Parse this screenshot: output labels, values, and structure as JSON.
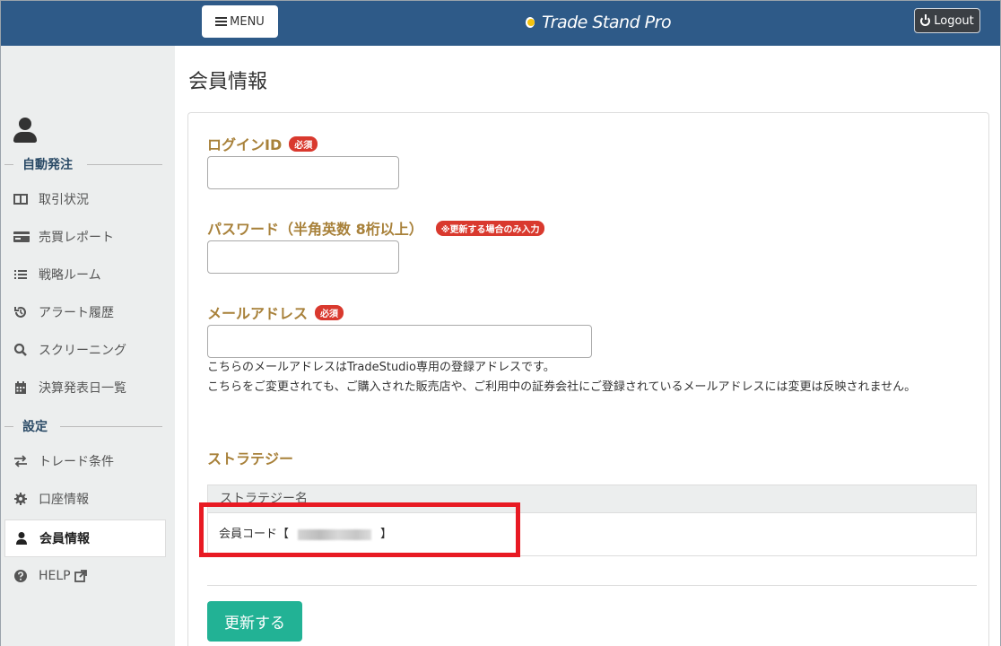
{
  "header": {
    "menu_label": "MENU",
    "logo_text": "Trade Stand Pro",
    "logout_label": "Logout"
  },
  "sidebar": {
    "section_auto": "自動発注",
    "section_settings": "設定",
    "items": [
      {
        "label": "取引状況",
        "icon": "columns-icon"
      },
      {
        "label": "売買レポート",
        "icon": "card-icon"
      },
      {
        "label": "戦略ルーム",
        "icon": "list-icon"
      },
      {
        "label": "アラート履歴",
        "icon": "history-icon"
      },
      {
        "label": "スクリーニング",
        "icon": "search-icon"
      },
      {
        "label": "決算発表日一覧",
        "icon": "calendar-icon"
      },
      {
        "label": "トレード条件",
        "icon": "exchange-icon"
      },
      {
        "label": "口座情報",
        "icon": "gear-icon"
      },
      {
        "label": "会員情報",
        "icon": "user-icon"
      },
      {
        "label": "HELP",
        "icon": "question-icon"
      }
    ]
  },
  "main": {
    "title": "会員情報",
    "login_id_label": "ログインID",
    "required_badge": "必須",
    "password_label": "パスワード（半角英数 8桁以上）",
    "password_badge": "※更新する場合のみ入力",
    "email_label": "メールアドレス",
    "email_help_1": "こちらのメールアドレスはTradeStudio専用の登録アドレスです。",
    "email_help_2": "こちらをご変更されても、ご購入された販売店や、ご利用中の証券会社にご登録されているメールアドレスには変更は反映されません。",
    "strategy_label": "ストラテジー",
    "strategy_column": "ストラテジー名",
    "member_code_prefix": "会員コード【",
    "member_code_suffix": "】",
    "submit_label": "更新する"
  },
  "colors": {
    "header_bg": "#2e5a88",
    "label_gold": "#a8813a",
    "badge_red": "#d9392e",
    "submit_green": "#22b295",
    "highlight_red": "#e81a23"
  }
}
